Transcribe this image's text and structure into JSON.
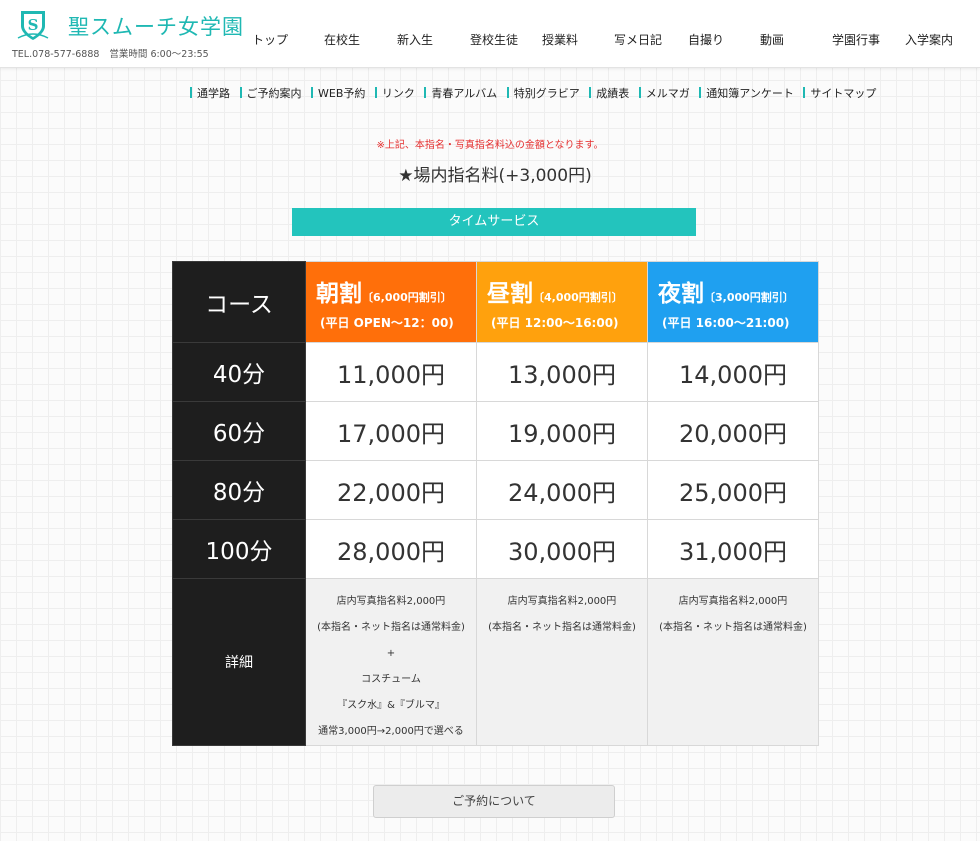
{
  "header": {
    "logo_title": "聖スムーチ女学園",
    "tel": "TEL.078-577-6888",
    "hours": "営業時間 6:00〜23:55",
    "nav": [
      "トップ",
      "在校生",
      "新入生",
      "登校生徒",
      "授業料",
      "写メ日記",
      "自撮り",
      "動画",
      "学園行事",
      "入学案内"
    ]
  },
  "subnav": [
    "通学路",
    "ご予約案内",
    "WEB予約",
    "リンク",
    "青春アルバム",
    "特別グラビア",
    "成績表",
    "メルマガ",
    "通知簿アンケート",
    "サイトマップ"
  ],
  "note": "※上記、本指名・写真指名料込の金額となります。",
  "fee": "★場内指名料(+3,000円)",
  "time_service": "タイムサービス",
  "table": {
    "course_header": "コース",
    "plans": [
      {
        "name": "朝割",
        "discount": "〔6,000円割引〕",
        "hours": "(平日 OPEN〜12：00)"
      },
      {
        "name": "昼割",
        "discount": "〔4,000円割引〕",
        "hours": "(平日 12:00〜16:00)"
      },
      {
        "name": "夜割",
        "discount": "〔3,000円割引〕",
        "hours": "(平日 16:00〜21:00)"
      }
    ],
    "rows": [
      {
        "course": "40分",
        "prices": [
          "11,000円",
          "13,000円",
          "14,000円"
        ]
      },
      {
        "course": "60分",
        "prices": [
          "17,000円",
          "19,000円",
          "20,000円"
        ]
      },
      {
        "course": "80分",
        "prices": [
          "22,000円",
          "24,000円",
          "25,000円"
        ]
      },
      {
        "course": "100分",
        "prices": [
          "28,000円",
          "30,000円",
          "31,000円"
        ]
      }
    ],
    "detail_label": "詳細",
    "details": [
      [
        "店内写真指名料2,000円",
        "(本指名・ネット指名は通常料金)",
        "+",
        "コスチューム",
        "『スク水』&『ブルマ』",
        "通常3,000円→2,000円で選べる"
      ],
      [
        "店内写真指名料2,000円",
        "(本指名・ネット指名は通常料金)"
      ],
      [
        "店内写真指名料2,000円",
        "(本指名・ネット指名は通常料金)"
      ]
    ]
  },
  "reserve_button": "ご予約について",
  "colors": {
    "brand": "#1fb8b3",
    "asa": "#ff6f0a",
    "hiru": "#ffa10d",
    "yoru": "#1fa0f0",
    "note_red": "#e53030"
  }
}
